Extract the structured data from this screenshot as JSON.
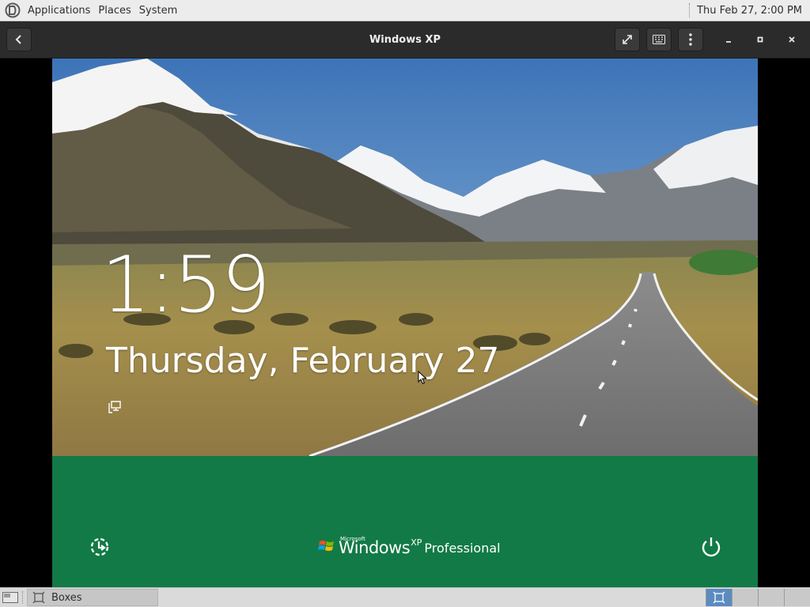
{
  "top_panel": {
    "menus": [
      "Applications",
      "Places",
      "System"
    ],
    "clock": "Thu Feb 27,  2:00 PM"
  },
  "header_bar": {
    "title": "Windows XP",
    "icons": [
      "go-back-icon",
      "fullscreen-icon",
      "keyboard-icon",
      "menu-dots-icon",
      "minimize-icon",
      "maximize-icon",
      "close-icon"
    ]
  },
  "lock_screen": {
    "time": "1:59",
    "date": "Thursday, February 27",
    "band_color": "#127a46",
    "brand": {
      "microsoft": "Microsoft",
      "windows": "Windows",
      "xp": "XP",
      "edition": "Professional"
    }
  },
  "bottom_panel": {
    "task_label": "Boxes",
    "workspaces": 4,
    "active_workspace": 1
  }
}
